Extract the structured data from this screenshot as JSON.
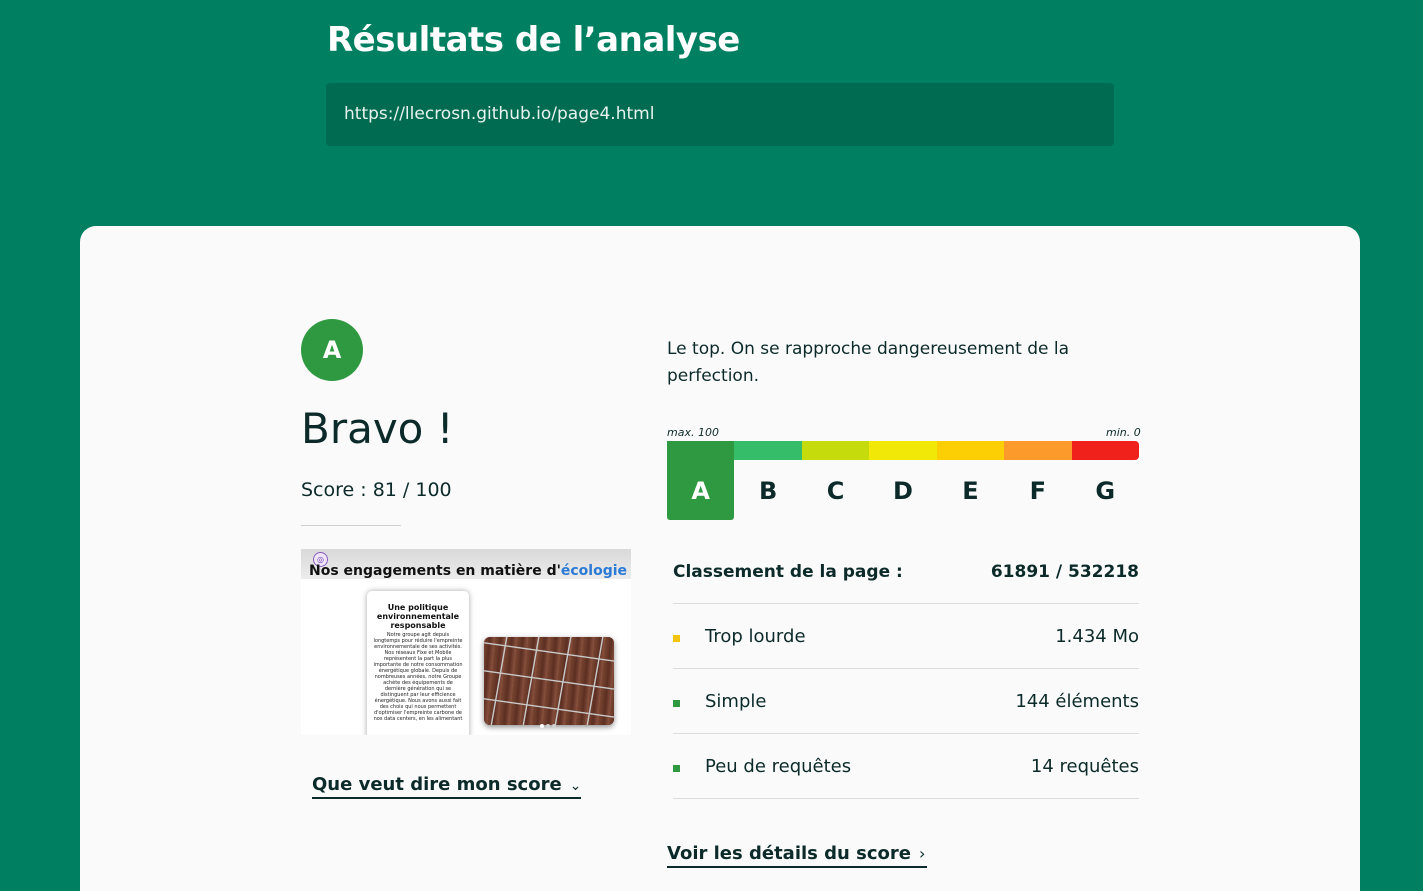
{
  "header": {
    "title": "Résultats de l’analyse",
    "url": "https://llecrosn.github.io/page4.html"
  },
  "result": {
    "grade": "A",
    "headline": "Bravo !",
    "score_text": "Score : 81 / 100",
    "score": 81,
    "score_max": 100,
    "tagline": "Le top. On se rapproche dangereusement de la perfection.",
    "score_link": "Que veut dire mon score",
    "details_link": "Voir les détails du score"
  },
  "thumbnail": {
    "logo_glyph": "◎",
    "heading_prefix": "Nos engagements en matière d'",
    "heading_highlight": "écologie",
    "card_title": "Une politique environnementale responsable",
    "card_text": "Notre groupe agit depuis longtemps pour réduire l'empreinte environnementale de ses activités. Nos réseaux Fixe et Mobile représentent la part la plus importante de notre consommation énergétique globale. Depuis de nombreuses années, notre Groupe achète des équipements de dernière génération qui se distinguent par leur efficience énergétique. Nous avons aussi fait des choix qui nous permettent d'optimiser l'empreinte carbone de nos data centers, en les alimentant"
  },
  "scale": {
    "max_label": "max. 100",
    "min_label": "min. 0",
    "active": "A",
    "grades": [
      {
        "label": "A",
        "color": "#2e9941"
      },
      {
        "label": "B",
        "color": "#36bd6a"
      },
      {
        "label": "C",
        "color": "#c6db0c"
      },
      {
        "label": "D",
        "color": "#f2e808"
      },
      {
        "label": "E",
        "color": "#fccf04"
      },
      {
        "label": "F",
        "color": "#fc9a2c"
      },
      {
        "label": "G",
        "color": "#f0201b"
      }
    ]
  },
  "ranking": {
    "label": "Classement de la page :",
    "value": "61891 / 532218"
  },
  "metrics": [
    {
      "label": "Trop lourde",
      "value": "1.434 Mo",
      "color": "#f2c40a"
    },
    {
      "label": "Simple",
      "value": "144 éléments",
      "color": "#2e9941"
    },
    {
      "label": "Peu de requêtes",
      "value": "14 requêtes",
      "color": "#2e9941"
    }
  ]
}
